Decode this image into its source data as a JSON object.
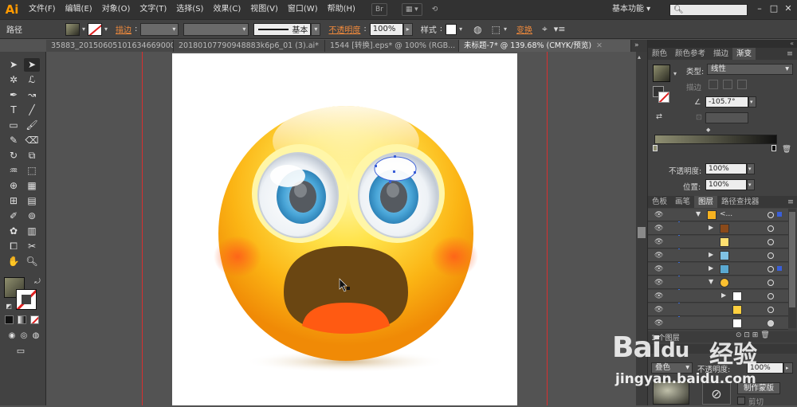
{
  "app": {
    "logo": "Ai",
    "workspace": "基本功能"
  },
  "menu": [
    "文件(F)",
    "编辑(E)",
    "对象(O)",
    "文字(T)",
    "选择(S)",
    "效果(C)",
    "视图(V)",
    "窗口(W)",
    "帮助(H)"
  ],
  "menu_icons": {
    "bridge": "Br"
  },
  "control": {
    "selection_type": "路径",
    "stroke_label": "描边",
    "stroke_style": "基本",
    "opacity_label": "不透明度",
    "opacity_value": "100%",
    "style_label": "样式",
    "transform_label": "变换"
  },
  "tabs": [
    {
      "label": "35883_20150605101634669000.ai*",
      "active": false
    },
    {
      "label": "20180107790948883k6p6_01 (3).ai*",
      "active": false
    },
    {
      "label": "1544 [转换].eps* @ 100% (RGB...",
      "active": false
    },
    {
      "label": "未标题-7* @ 139.68% (CMYK/预览)",
      "active": true
    }
  ],
  "gradient_panel": {
    "tabs": [
      "颜色",
      "颜色参考",
      "描边",
      "渐变"
    ],
    "active_tab": "渐变",
    "type_label": "类型",
    "type_value": "线性",
    "stroke_label": "描边",
    "angle_value": "-105.7°",
    "opacity_label": "不透明度",
    "opacity_value": "100%",
    "location_label": "位置",
    "location_value": "100%"
  },
  "layers_panel": {
    "tabs": [
      "色板",
      "画笔",
      "图层",
      "路径查找器"
    ],
    "active_tab": "图层",
    "top_layer_label": "<...",
    "footer_label": "1 个图层"
  },
  "transparency_panel": {
    "mode": "叠色",
    "opacity_label": "不透明度",
    "opacity_value": "100%",
    "make_mask": "制作蒙版",
    "clip": "剪切"
  },
  "watermark": {
    "brand": "Bai",
    "paw": "du",
    "jingyan": "经验",
    "url": "jingyan.baidu.com"
  },
  "colors": {
    "face_outer": "#f28a06",
    "face_inner": "#fff6a0",
    "mouth": "#6a4612",
    "tongue": "#ff5a12",
    "iris": "#4aa6d8",
    "pupil": "#555a60",
    "guide": "#d83030"
  }
}
